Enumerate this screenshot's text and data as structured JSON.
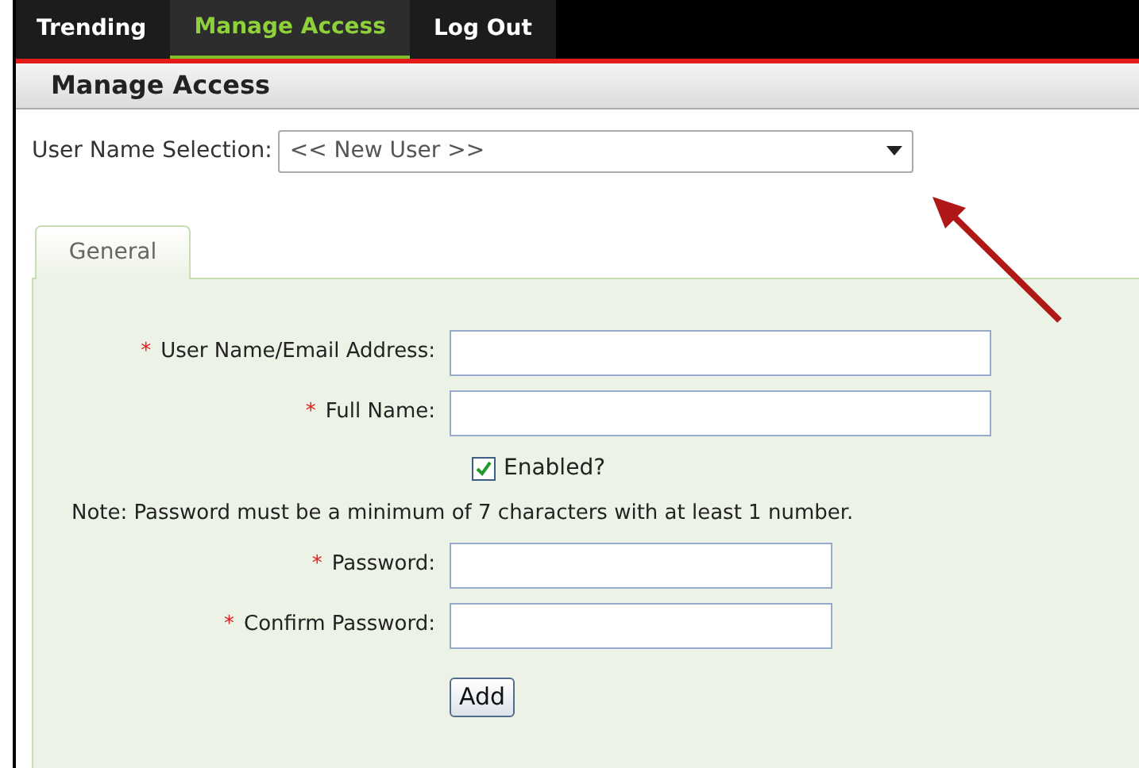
{
  "nav_tabs": [
    {
      "label": "Trending",
      "selected": false
    },
    {
      "label": "Manage Access",
      "selected": true
    },
    {
      "label": "Log Out",
      "selected": false
    }
  ],
  "page_title": "Manage Access",
  "user_selection": {
    "label": "User Name Selection:",
    "value": "<< New User >>"
  },
  "panel_tabs": [
    {
      "label": "General",
      "selected": true
    }
  ],
  "form": [
    {
      "kind": "field",
      "mark": "*",
      "label": "User Name/Email Address:"
    },
    {
      "kind": "field",
      "mark": "*",
      "label": "Full Name:"
    },
    {
      "kind": "checkbox",
      "label": "Enabled?",
      "checked": true
    },
    {
      "kind": "note",
      "label": "Note: Password must be a minimum of 7 characters with at least 1 number."
    },
    {
      "kind": "shortfield",
      "mark": "*",
      "label": "Password:"
    },
    {
      "kind": "shortfield",
      "mark": "*",
      "label": "Confirm Password:"
    }
  ],
  "submit_button": "Add"
}
